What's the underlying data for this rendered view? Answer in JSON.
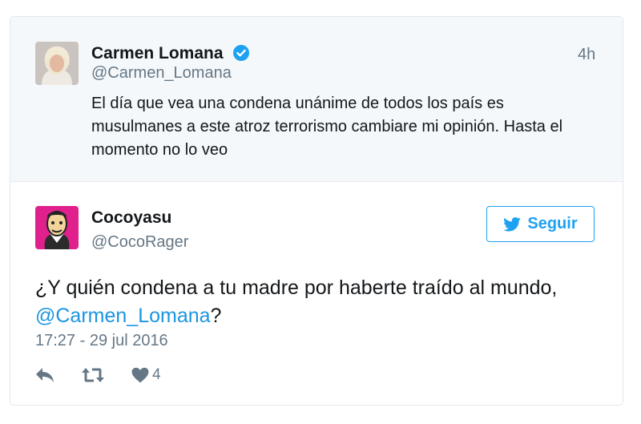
{
  "quoted_tweet": {
    "author_name": "Carmen Lomana",
    "author_handle": "@Carmen_Lomana",
    "verified_icon": "verified-badge-icon",
    "time": "4h",
    "text": "El día que vea una condena unánime de todos los país es musulmanes a este atroz terrorismo cambiare mi opinión. Hasta el momento no lo veo"
  },
  "tweet": {
    "author_name": "Cocoyasu",
    "author_handle": "@CocoRager",
    "follow_label": "Seguir",
    "text_before": "¿Y quién condena a tu madre por haberte traído al mundo, ",
    "mention": "@Carmen_Lomana",
    "text_after": "?",
    "date": "17:27 - 29 jul 2016",
    "like_count": "4",
    "icons": [
      "reply-icon",
      "retweet-icon",
      "heart-icon",
      "twitter-bird-icon"
    ]
  },
  "colors": {
    "accent": "#1da1f2",
    "mention": "#1b95e0",
    "muted": "#657786",
    "quoted_bg": "#f5f8fa"
  }
}
